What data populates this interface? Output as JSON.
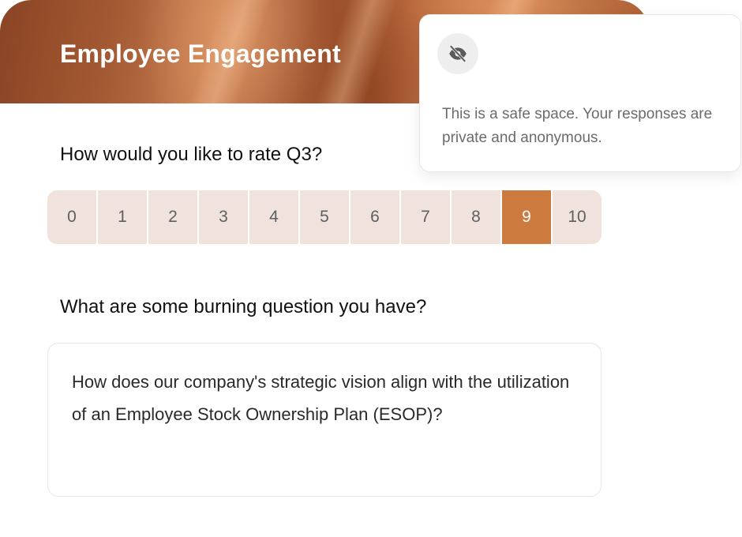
{
  "header": {
    "title": "Employee Engagement"
  },
  "privacy_tooltip": {
    "icon": "eye-off-icon",
    "message": "This is a safe space. Your responses are private and anonymous."
  },
  "rating_question": {
    "label": "How would you like to rate Q3?",
    "options": [
      "0",
      "1",
      "2",
      "3",
      "4",
      "5",
      "6",
      "7",
      "8",
      "9",
      "10"
    ],
    "selected": "9",
    "selected_color": "#cd7a3f",
    "option_color": "#f0e3de"
  },
  "text_question": {
    "label": "What are some burning question you have?",
    "answer": "How does our company's strategic vision align with the utilization of an Employee Stock Ownership Plan (ESOP)?"
  }
}
